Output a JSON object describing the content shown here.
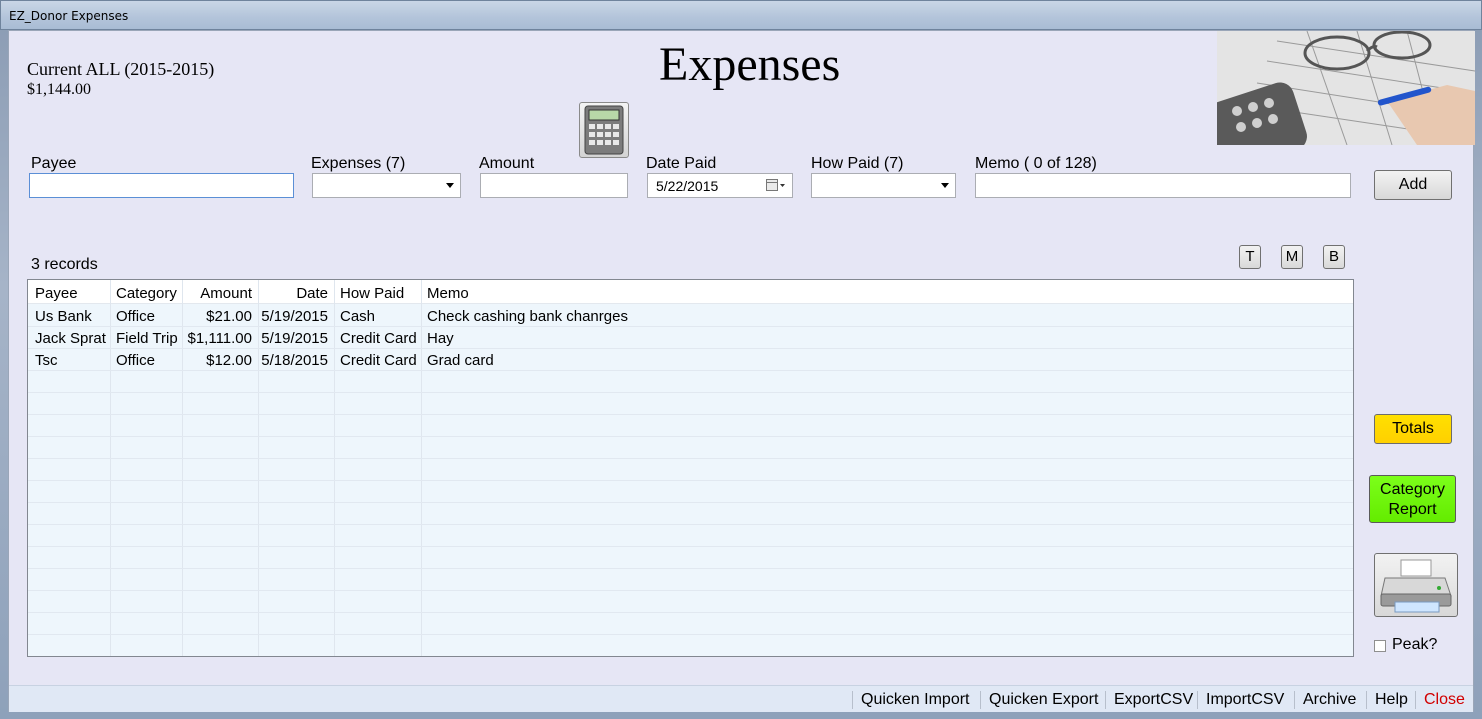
{
  "window": {
    "title": "EZ_Donor Expenses"
  },
  "header": {
    "season": "Current ALL (2015-2015)",
    "total": "$1,144.00",
    "title": "Expenses"
  },
  "form": {
    "payee_label": "Payee",
    "payee_value": "",
    "expenses_label": "Expenses (7)",
    "expenses_value": "",
    "amount_label": "Amount",
    "amount_value": "",
    "date_label": "Date Paid",
    "date_value": "5/22/2015",
    "howpaid_label": "How Paid (7)",
    "howpaid_value": "",
    "memo_label": "Memo ( 0 of 128)",
    "memo_value": "",
    "add_label": "Add"
  },
  "list": {
    "count": "3 records",
    "view_buttons": [
      "T",
      "M",
      "B"
    ],
    "columns": [
      "Payee",
      "Category",
      "Amount",
      "Date",
      "How Paid",
      "Memo"
    ],
    "rows": [
      [
        "Us Bank",
        "Office",
        "$21.00",
        "5/19/2015",
        "Cash",
        "Check cashing bank chanrges"
      ],
      [
        "Jack Sprat",
        "Field Trip",
        "$1,111.00",
        "5/19/2015",
        "Credit Card",
        "Hay"
      ],
      [
        "Tsc",
        "Office",
        "$12.00",
        "5/18/2015",
        "Credit Card",
        "Grad card"
      ]
    ]
  },
  "side": {
    "totals_label": "Totals",
    "category_label_1": "Category",
    "category_label_2": "Report",
    "print_icon": "printer-icon",
    "peak_label": "Peak?"
  },
  "footer": {
    "links": [
      "Quicken Import",
      "Quicken Export",
      "ExportCSV",
      "ImportCSV",
      "Archive",
      "Help"
    ],
    "close_label": "Close"
  },
  "colors": {
    "totals": "#ffd800",
    "category": "#6cf000",
    "close": "#d10000"
  }
}
